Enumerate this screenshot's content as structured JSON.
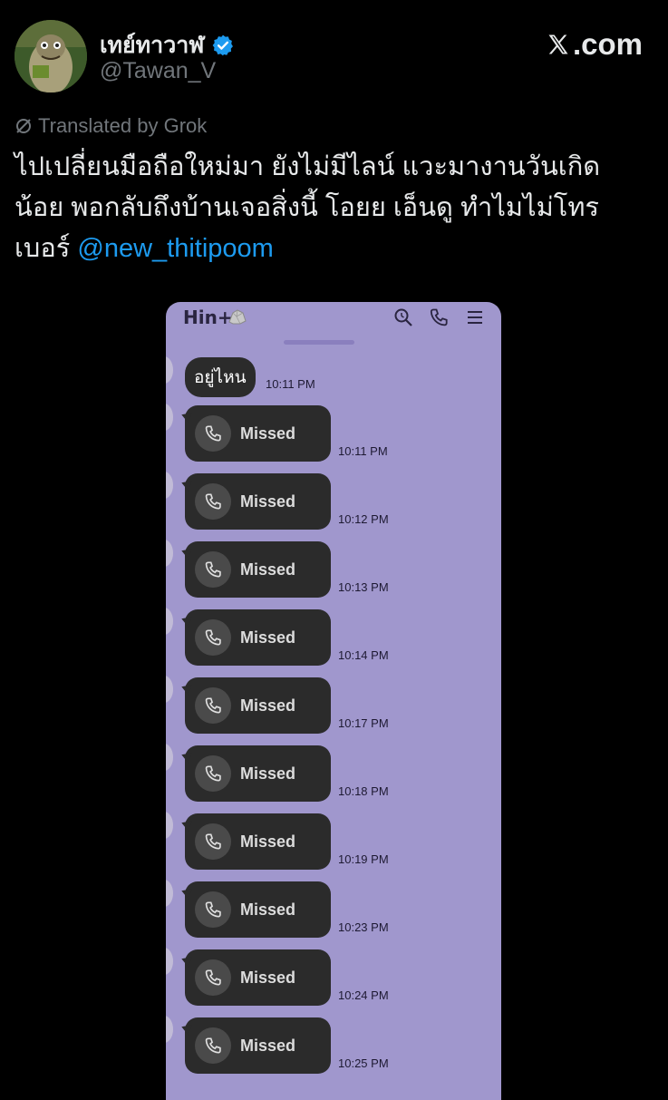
{
  "tweet": {
    "display_name": "เทย์ทาวาฬ",
    "handle": "@Tawan_V",
    "brand": ".com",
    "translated_label": "Translated by Grok",
    "text_lines": [
      "ไปเปลี่ยนมือถือใหม่มา ยังไม่มีไลน์ แวะมางานวันเกิด",
      "น้อย พอกลับถึงบ้านเจอสิ่งนี้ โอยย เอ็นดู ทำไมไม่โทร"
    ],
    "text_last_prefix": "เบอร์ ",
    "mention": "@new_thitipoom",
    "colors": {
      "accent": "#1d9bf0",
      "muted": "#71767b",
      "chat_bg": "#a097cd"
    }
  },
  "chat": {
    "title": "Hin+",
    "first_message": {
      "text": "อยู่ไหน",
      "time": "10:11 PM"
    },
    "missed_calls": [
      {
        "label": "Missed",
        "time": "10:11 PM"
      },
      {
        "label": "Missed",
        "time": "10:12 PM"
      },
      {
        "label": "Missed",
        "time": "10:13 PM"
      },
      {
        "label": "Missed",
        "time": "10:14 PM"
      },
      {
        "label": "Missed",
        "time": "10:17 PM"
      },
      {
        "label": "Missed",
        "time": "10:18 PM"
      },
      {
        "label": "Missed",
        "time": "10:19 PM"
      },
      {
        "label": "Missed",
        "time": "10:23 PM"
      },
      {
        "label": "Missed",
        "time": "10:24 PM"
      },
      {
        "label": "Missed",
        "time": "10:25 PM"
      }
    ],
    "icons": [
      "rock-emoji",
      "search-icon",
      "phone-icon",
      "menu-icon",
      "phone-missed-icon"
    ]
  }
}
